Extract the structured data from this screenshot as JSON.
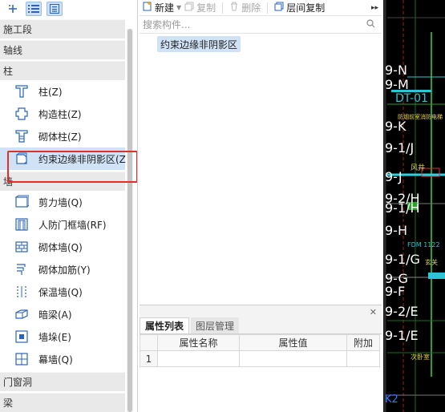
{
  "left_panel": {
    "toolbar": [
      "add-icon",
      "list-view-icon",
      "detail-view-icon"
    ],
    "categories": [
      {
        "label": "施工段",
        "items": []
      },
      {
        "label": "轴线",
        "items": []
      },
      {
        "label": "柱",
        "items": [
          {
            "label": "柱(Z)",
            "icon": "column-icon"
          },
          {
            "label": "构造柱(Z)",
            "icon": "constructional-column-icon"
          },
          {
            "label": "砌体柱(Z)",
            "icon": "masonry-column-icon"
          },
          {
            "label": "约束边缘非阴影区(Z",
            "icon": "constraint-edge-icon",
            "selected": true
          }
        ]
      },
      {
        "label": "墙",
        "items": [
          {
            "label": "剪力墙(Q)",
            "icon": "shear-wall-icon"
          },
          {
            "label": "人防门框墙(RF)",
            "icon": "civil-defense-door-wall-icon"
          },
          {
            "label": "砌体墙(Q)",
            "icon": "masonry-wall-icon"
          },
          {
            "label": "砌体加筋(Y)",
            "icon": "masonry-reinforcement-icon"
          },
          {
            "label": "保温墙(Q)",
            "icon": "insulation-wall-icon"
          },
          {
            "label": "暗梁(A)",
            "icon": "hidden-beam-icon"
          },
          {
            "label": "墙垛(E)",
            "icon": "wall-pier-icon"
          },
          {
            "label": "幕墙(Q)",
            "icon": "curtain-wall-icon"
          }
        ]
      },
      {
        "label": "门窗洞",
        "items": []
      },
      {
        "label": "梁",
        "items": []
      }
    ]
  },
  "mid_panel": {
    "toolbar": {
      "new_label": "新建",
      "copy_label": "复制",
      "delete_label": "删除",
      "floor_copy_label": "层间复制",
      "more_label": "▸▸"
    },
    "search_placeholder": "搜索构件...",
    "tree_node": "约束边缘非阴影区",
    "properties": {
      "close_label": "✕",
      "tab_active": "属性列表",
      "tab_inactive": "图层管理",
      "columns": [
        "属性名称",
        "属性值",
        "附加"
      ],
      "rows": [
        {
          "num": "1"
        }
      ]
    }
  },
  "cad": {
    "labels": [
      {
        "text": "9-N",
        "color": "#ffffff"
      },
      {
        "text": "9-M",
        "color": "#ffffff"
      },
      {
        "text": "DT-01",
        "color": "#2ec4d6"
      },
      {
        "text": "9-K",
        "color": "#ffffff"
      },
      {
        "text": "9-1/J",
        "color": "#ffffff"
      },
      {
        "text": "9-J",
        "color": "#ffffff"
      },
      {
        "text": "9-2/H",
        "color": "#ffffff"
      },
      {
        "text": "9-1/H",
        "color": "#ffffff"
      },
      {
        "text": "9-H",
        "color": "#ffffff"
      },
      {
        "text": "9-1/G",
        "color": "#ffffff"
      },
      {
        "text": "9-G",
        "color": "#ffffff"
      },
      {
        "text": "9-F",
        "color": "#ffffff"
      },
      {
        "text": "9-2/E",
        "color": "#ffffff"
      },
      {
        "text": "9-1/E",
        "color": "#ffffff"
      },
      {
        "text": "K2",
        "color": "#3a78ff"
      }
    ]
  }
}
